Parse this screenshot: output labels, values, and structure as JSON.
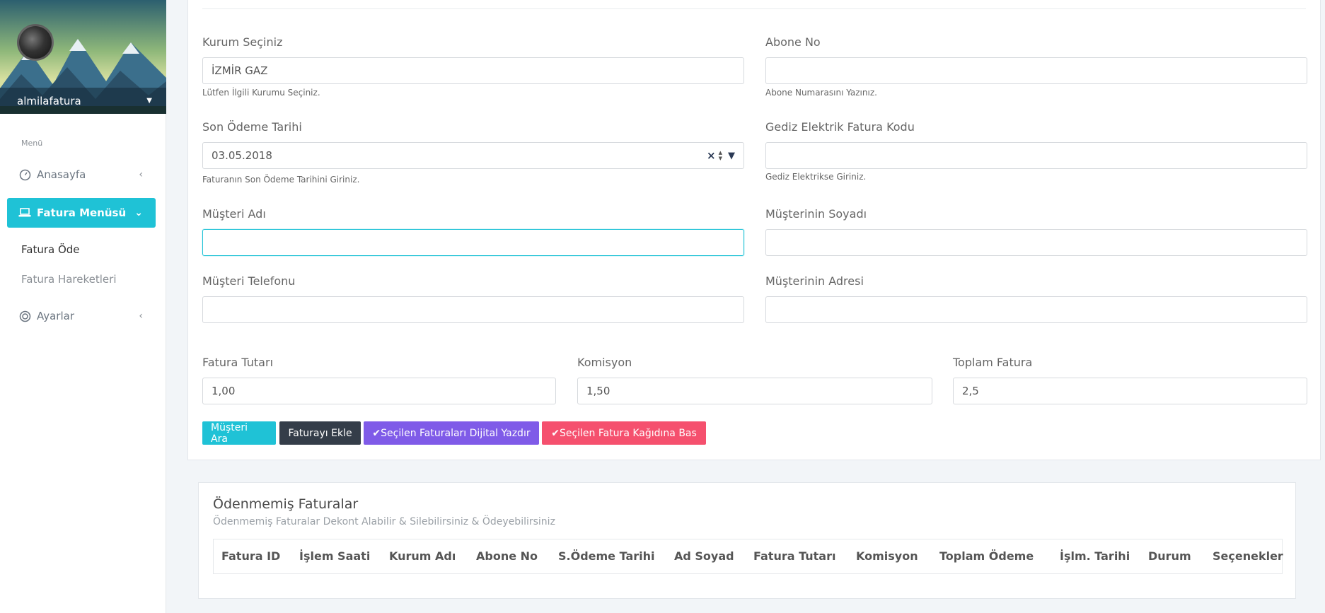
{
  "sidebar": {
    "username": "almilafatura",
    "menu_title": "Menü",
    "items": [
      {
        "label": "Anasayfa",
        "icon": "dashboard-icon"
      },
      {
        "label": "Fatura Menüsü",
        "icon": "laptop-icon"
      },
      {
        "label": "Ayarlar",
        "icon": "target-icon"
      }
    ],
    "sub_items": [
      {
        "label": "Fatura Öde"
      },
      {
        "label": "Fatura Hareketleri"
      }
    ]
  },
  "form": {
    "kurum": {
      "label": "Kurum Seçiniz",
      "value": "İZMİR GAZ",
      "help": "Lütfen İlgili Kurumu Seçiniz."
    },
    "abone": {
      "label": "Abone No",
      "value": "",
      "help": "Abone Numarasını Yazınız."
    },
    "son_odeme": {
      "label": "Son Ödeme Tarihi",
      "value": "03.05.2018",
      "help": "Faturanın Son Ödeme Tarihini Giriniz."
    },
    "gediz": {
      "label": "Gediz Elektrik Fatura Kodu",
      "value": "",
      "help": "Gediz Elektrikse Giriniz."
    },
    "musteri_adi": {
      "label": "Müşteri Adı",
      "value": ""
    },
    "musteri_soyadi": {
      "label": "Müşterinin Soyadı",
      "value": ""
    },
    "musteri_tel": {
      "label": "Müşteri Telefonu",
      "value": ""
    },
    "musteri_adres": {
      "label": "Müşterinin Adresi",
      "value": ""
    },
    "fatura_tutari": {
      "label": "Fatura Tutarı",
      "value": "1,00"
    },
    "komisyon": {
      "label": "Komisyon",
      "value": "1,50"
    },
    "toplam": {
      "label": "Toplam Fatura",
      "value": "2,5"
    }
  },
  "buttons": {
    "musteri_ara": "Müşteri Ara",
    "fatura_ekle": "Faturayı Ekle",
    "dijital_yazdir": "Seçilen Faturaları Dijital Yazdır",
    "kagida_bas": "Seçilen Fatura Kağıdına Bas"
  },
  "unpaid": {
    "title": "Ödenmemiş Faturalar",
    "subtitle": "Ödenmemiş Faturalar Dekont Alabilir & Silebilirsiniz & Ödeyebilirsiniz",
    "columns": [
      "Fatura ID",
      "İşlem Saati",
      "Kurum Adı",
      "Abone No",
      "S.Ödeme Tarihi",
      "Ad Soyad",
      "Fatura Tutarı",
      "Komisyon",
      "Toplam Ödeme",
      "İşlm. Tarihi",
      "Durum",
      "Seçenekler"
    ]
  },
  "colors": {
    "accent": "#1fc2d6",
    "dark": "#343d49",
    "purple": "#7f5be8",
    "pink": "#f5506e"
  }
}
